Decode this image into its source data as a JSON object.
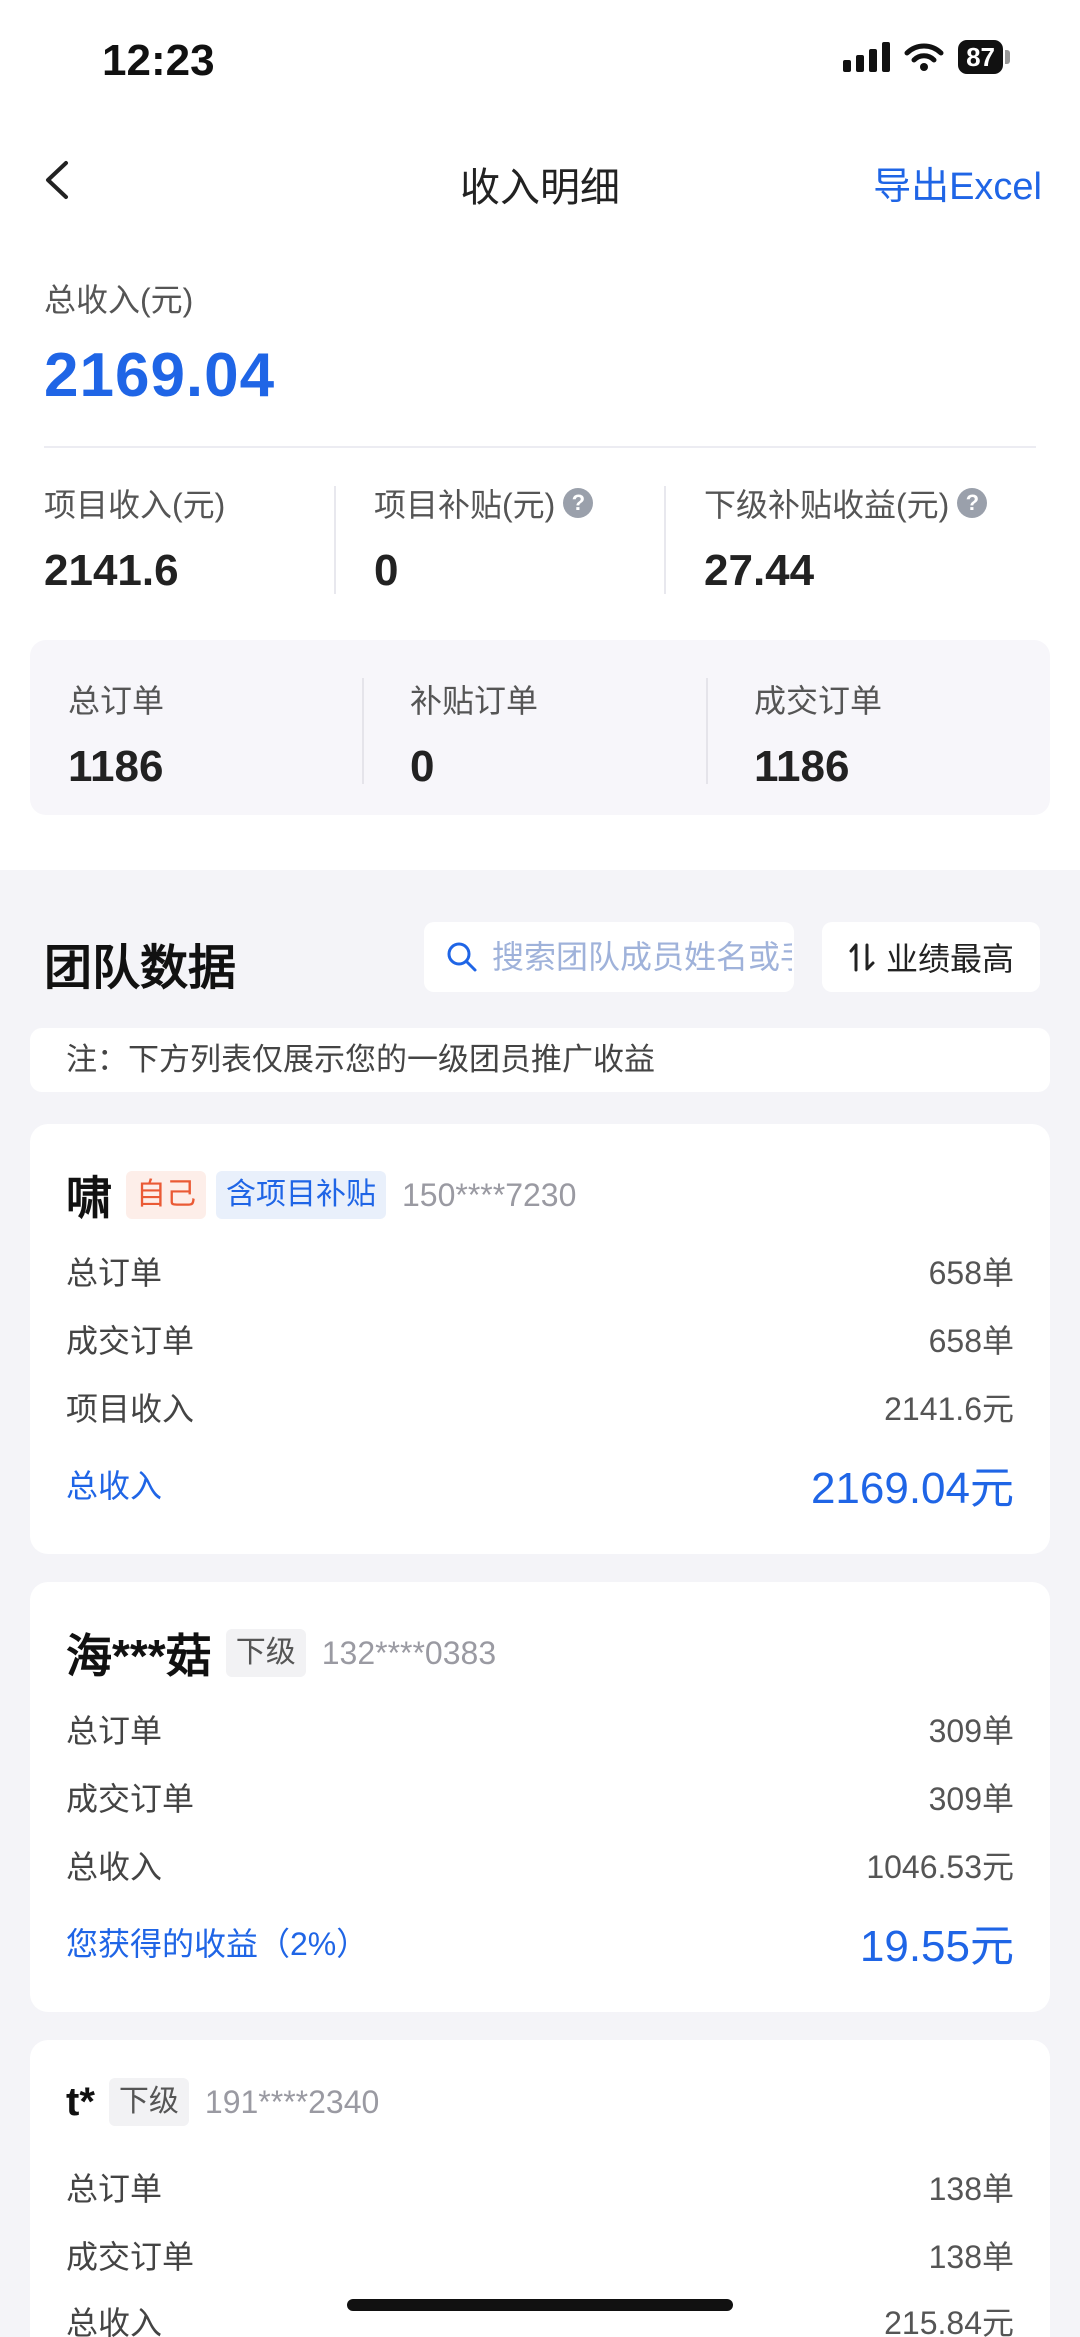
{
  "status_bar": {
    "time": "12:23",
    "battery": "87"
  },
  "nav": {
    "title": "收入明细",
    "export_label": "导出Excel"
  },
  "summary": {
    "total_label": "总收入(元)",
    "total_value": "2169.04",
    "project_income_label": "项目收入(元)",
    "project_income_value": "2141.6",
    "project_subsidy_label": "项目补贴(元)",
    "project_subsidy_value": "0",
    "sub_income_label": "下级补贴收益(元)",
    "sub_income_value": "27.44"
  },
  "orders": {
    "total_label": "总订单",
    "total_value": "1186",
    "subsidy_label": "补贴订单",
    "subsidy_value": "0",
    "deal_label": "成交订单",
    "deal_value": "1186"
  },
  "team": {
    "title": "团队数据",
    "search_placeholder": "搜索团队成员姓名或手机号",
    "sort_label": "业绩最高",
    "note": "注：下方列表仅展示您的一级团员推广收益"
  },
  "members": [
    {
      "name": "啸",
      "tag_self": "自己",
      "tag_subsidy": "含项目补贴",
      "phone": "150****7230",
      "rows": [
        {
          "label": "总订单",
          "value": "658单"
        },
        {
          "label": "成交订单",
          "value": "658单"
        },
        {
          "label": "项目收入",
          "value": "2141.6元"
        }
      ],
      "highlight": {
        "label": "总收入",
        "value": "2169.04元"
      }
    },
    {
      "name": "海***菇",
      "tag_level": "下级",
      "phone": "132****0383",
      "rows": [
        {
          "label": "总订单",
          "value": "309单"
        },
        {
          "label": "成交订单",
          "value": "309单"
        },
        {
          "label": "总收入",
          "value": "1046.53元"
        }
      ],
      "highlight": {
        "label": "您获得的收益（2%）",
        "value": "19.55元"
      }
    },
    {
      "name": "t*",
      "tag_level": "下级",
      "phone": "191****2340",
      "rows": [
        {
          "label": "总订单",
          "value": "138单"
        },
        {
          "label": "成交订单",
          "value": "138单"
        },
        {
          "label": "总收入",
          "value": "215.84元"
        }
      ]
    }
  ],
  "colors": {
    "accent": "#1f65e6",
    "self_tag": "#ea5a35",
    "background": "#f4f4f8"
  }
}
